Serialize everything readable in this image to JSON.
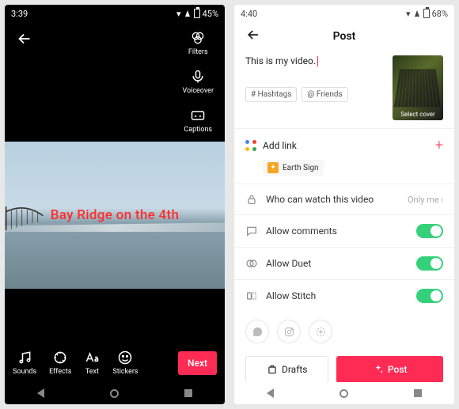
{
  "left": {
    "status": {
      "time": "3:39",
      "battery": "45%"
    },
    "tools_right": {
      "filters": "Filters",
      "voiceover": "Voiceover",
      "captions": "Captions"
    },
    "overlay_caption": "Bay Ridge on the 4th",
    "tools_bottom": {
      "sounds": "Sounds",
      "effects": "Effects",
      "text": "Text",
      "stickers": "Stickers"
    },
    "next_label": "Next"
  },
  "right": {
    "status": {
      "time": "4:40",
      "battery": "68%"
    },
    "header_title": "Post",
    "compose_text": "This is my video.",
    "chip_hashtags": "# Hashtags",
    "chip_friends": "@ Friends",
    "cover_label": "Select cover",
    "addlink_label": "Add link",
    "effect_name": "Earth Sign",
    "privacy_label": "Who can watch this video",
    "privacy_value": "Only me",
    "allow_comments": "Allow comments",
    "allow_duet": "Allow Duet",
    "allow_stitch": "Allow Stitch",
    "drafts_label": "Drafts",
    "post_label": "Post"
  }
}
